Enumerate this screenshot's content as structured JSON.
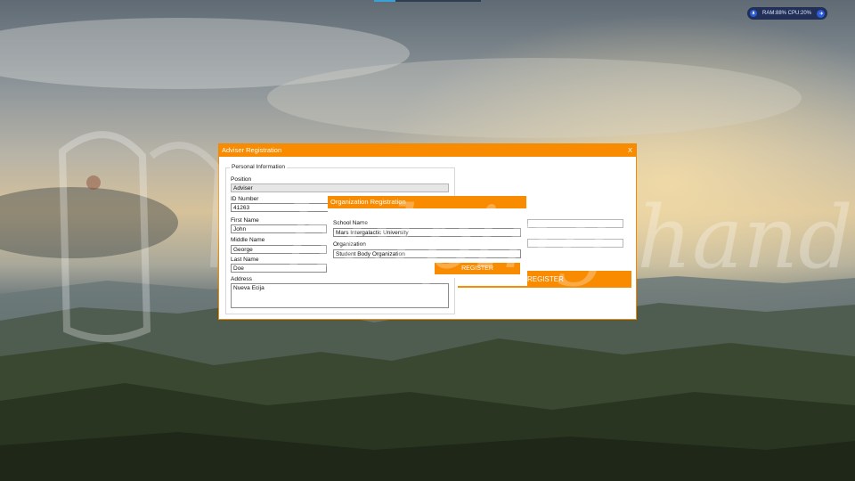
{
  "system_tray": {
    "stats": "RAM:88%   CPU:20%"
  },
  "watermark": {
    "text": "helping hand"
  },
  "dialog": {
    "title": "Adviser Registration",
    "close_label": "X",
    "personal_info": {
      "legend": "Personal Information",
      "position_label": "Position",
      "position_value": "Adviser",
      "id_label": "ID Number",
      "id_value": "41263",
      "first_name_label": "First Name",
      "first_name_value": "John",
      "middle_name_label": "Middle Name",
      "middle_name_value": "George",
      "last_name_label": "Last Name",
      "last_name_value": "Doe",
      "address_label": "Address",
      "address_value": "Nueva Ecija"
    },
    "register_label": "REGISTER"
  },
  "org_dialog": {
    "title": "Organization Registration",
    "school_label": "School Name",
    "school_value": "Mars Intergalactic University",
    "org_label": "Organization",
    "org_value": "Student Body Organization",
    "register_label": "REGISTER"
  },
  "colors": {
    "accent": "#f88b00",
    "tray": "#223058"
  }
}
